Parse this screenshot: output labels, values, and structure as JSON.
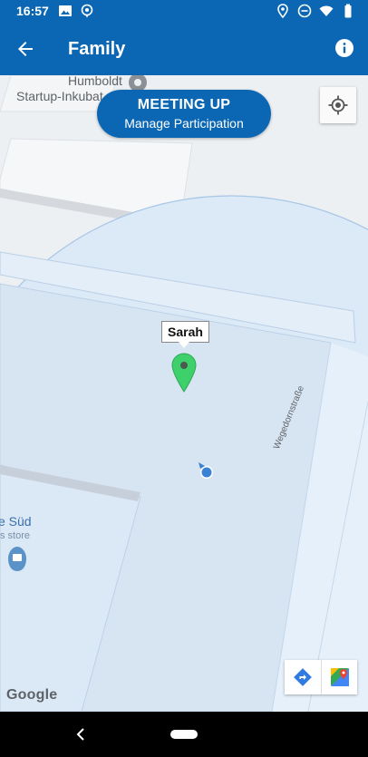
{
  "status_bar": {
    "time": "16:57",
    "left_icons": [
      "image-icon",
      "location-tracking-icon"
    ],
    "right_icons": [
      "location-icon",
      "do-not-disturb-icon",
      "wifi-icon",
      "battery-icon"
    ]
  },
  "app_bar": {
    "title": "Family",
    "back_icon": "arrow-back-icon",
    "info_icon": "info-icon"
  },
  "map": {
    "poi_top": {
      "line1": "Humboldt",
      "line2": "Startup-Inkubat"
    },
    "meeting": {
      "title": "MEETING UP",
      "subtitle": "Manage Participation"
    },
    "member_name": "Sarah",
    "street_name": "Wegedornstraße",
    "poi_left": {
      "name": "e Süd",
      "sub": "s store"
    },
    "attribution": "Google",
    "colors": {
      "brand": "#0b67b3",
      "pin": "#3dd06b",
      "my_location": "#3a82d6",
      "radius_fill": "#dce9f6"
    }
  },
  "nav_bar": {
    "back_icon": "nav-back-icon",
    "home_icon": "nav-home-pill"
  }
}
